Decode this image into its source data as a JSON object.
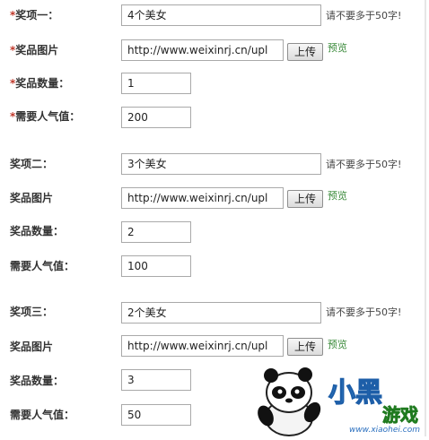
{
  "required_mark": "*",
  "prizes": [
    {
      "name_label": "奖项一：",
      "name_value": "4个美女",
      "hint": "请不要多于50字!",
      "image_label": "奖品图片",
      "image_url": "http://www.weixinrj.cn/upl",
      "upload_label": "上传",
      "preview_label": "预览",
      "count_label": "奖品数量：",
      "count_value": "1",
      "popularity_label": "需要人气值：",
      "popularity_value": "200"
    },
    {
      "name_label": "奖项二：",
      "name_value": "3个美女",
      "hint": "请不要多于50字!",
      "image_label": "奖品图片",
      "image_url": "http://www.weixinrj.cn/upl",
      "upload_label": "上传",
      "preview_label": "预览",
      "count_label": "奖品数量：",
      "count_value": "2",
      "popularity_label": "需要人气值：",
      "popularity_value": "100"
    },
    {
      "name_label": "奖项三：",
      "name_value": "2个美女",
      "hint": "请不要多于50字!",
      "image_label": "奖品图片",
      "image_url": "http://www.weixinrj.cn/upl",
      "upload_label": "上传",
      "preview_label": "预览",
      "count_label": "奖品数量：",
      "count_value": "3",
      "popularity_label": "需要人气值：",
      "popularity_value": "50"
    }
  ],
  "watermark": {
    "brand_text": "小黑游戏",
    "site_text": "www.xiaohei.com"
  }
}
